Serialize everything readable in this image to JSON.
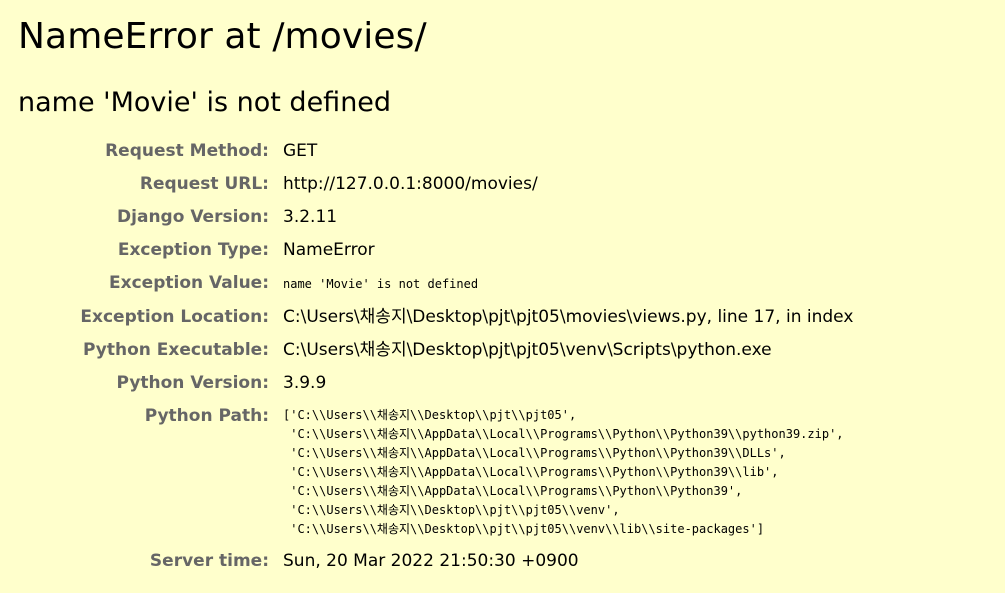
{
  "page": {
    "title": "NameError at /movies/",
    "subtitle": "name 'Movie' is not defined"
  },
  "meta": {
    "request_method": {
      "label": "Request Method:",
      "value": "GET"
    },
    "request_url": {
      "label": "Request URL:",
      "value": "http://127.0.0.1:8000/movies/"
    },
    "django_version": {
      "label": "Django Version:",
      "value": "3.2.11"
    },
    "exception_type": {
      "label": "Exception Type:",
      "value": "NameError"
    },
    "exception_value": {
      "label": "Exception Value:",
      "value": "name 'Movie' is not defined"
    },
    "exception_location": {
      "label": "Exception Location:",
      "value": "C:\\Users\\채송지\\Desktop\\pjt\\pjt05\\movies\\views.py, line 17, in index"
    },
    "python_executable": {
      "label": "Python Executable:",
      "value": "C:\\Users\\채송지\\Desktop\\pjt\\pjt05\\venv\\Scripts\\python.exe"
    },
    "python_version": {
      "label": "Python Version:",
      "value": "3.9.9"
    },
    "python_path": {
      "label": "Python Path:",
      "lines": [
        "['C:\\\\Users\\\\채송지\\\\Desktop\\\\pjt\\\\pjt05',",
        " 'C:\\\\Users\\\\채송지\\\\AppData\\\\Local\\\\Programs\\\\Python\\\\Python39\\\\python39.zip',",
        " 'C:\\\\Users\\\\채송지\\\\AppData\\\\Local\\\\Programs\\\\Python\\\\Python39\\\\DLLs',",
        " 'C:\\\\Users\\\\채송지\\\\AppData\\\\Local\\\\Programs\\\\Python\\\\Python39\\\\lib',",
        " 'C:\\\\Users\\\\채송지\\\\AppData\\\\Local\\\\Programs\\\\Python\\\\Python39',",
        " 'C:\\\\Users\\\\채송지\\\\Desktop\\\\pjt\\\\pjt05\\\\venv',",
        " 'C:\\\\Users\\\\채송지\\\\Desktop\\\\pjt\\\\pjt05\\\\venv\\\\lib\\\\site-packages']"
      ]
    },
    "server_time": {
      "label": "Server time:",
      "value": "Sun, 20 Mar 2022 21:50:30 +0900"
    }
  }
}
